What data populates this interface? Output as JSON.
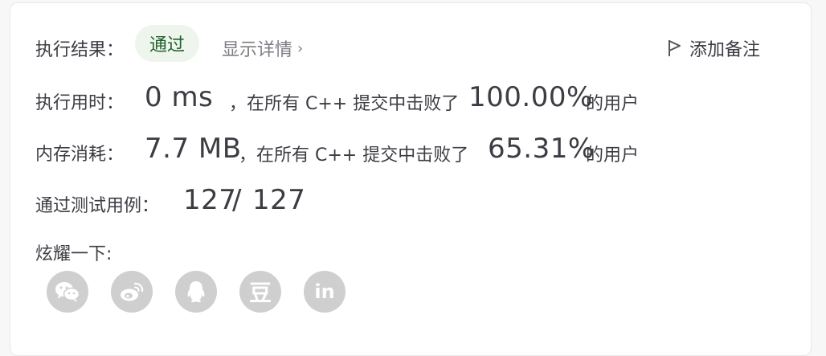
{
  "result": {
    "label": "执行结果：",
    "status": "通过",
    "details_link": "显示详情",
    "details_chevron": "›",
    "add_note": "添加备注"
  },
  "runtime": {
    "label": "执行用时：",
    "value": "0 ms",
    "middle_text": "，在所有 C++ 提交中击败了",
    "percent": "100.00%",
    "suffix": "的用户"
  },
  "memory": {
    "label": "内存消耗：",
    "value": "7.7 MB",
    "middle_text": "，在所有 C++ 提交中击败了",
    "percent": "65.31%",
    "suffix": "的用户"
  },
  "tests": {
    "label": "通过测试用例：",
    "passed": "127",
    "separator": "/",
    "total": "127"
  },
  "share": {
    "label": "炫耀一下:",
    "items": [
      {
        "icon": "wechat-icon"
      },
      {
        "icon": "weibo-icon"
      },
      {
        "icon": "qq-icon"
      },
      {
        "icon": "douban-icon",
        "text": "豆"
      },
      {
        "icon": "linkedin-icon",
        "text": "in"
      }
    ]
  },
  "colors": {
    "status_bg": "#eef5ec",
    "status_text": "#1f5f2c",
    "share_icon_bg": "#cfcfcf"
  }
}
